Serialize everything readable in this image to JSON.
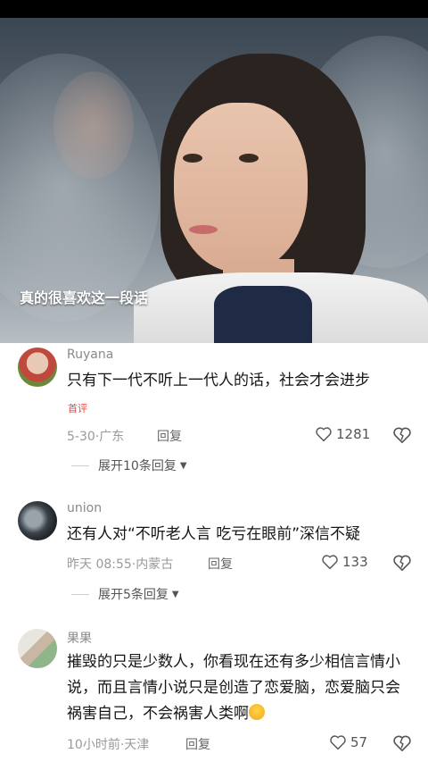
{
  "video": {
    "caption": "真的很喜欢这一段话"
  },
  "comments": [
    {
      "username": "Ruyana",
      "content": "只有下一代不听上一代人的话，社会才会进步",
      "badge": "首评",
      "date": "5-30",
      "location": "广东",
      "reply_label": "回复",
      "likes": "1281",
      "expand_label": "展开10条回复"
    },
    {
      "username": "union",
      "content": "还有人对“不听老人言 吃亏在眼前”深信不疑",
      "date": "昨天 08:55",
      "location": "内蒙古",
      "reply_label": "回复",
      "likes": "133",
      "expand_label": "展开5条回复"
    },
    {
      "username": "果果",
      "content": "摧毁的只是少数人，你看现在还有多少相信言情小说，而且言情小说只是创造了恋爱脑，恋爱脑只会祸害自己，不会祸害人类啊",
      "emoji": "rolling-on-floor-laughing-emoji",
      "date": "10小时前",
      "location": "天津",
      "reply_label": "回复",
      "likes": "57"
    }
  ],
  "colors": {
    "badge": "#e8453c",
    "meta": "#9a9a9a",
    "username": "#8a8a8a"
  }
}
